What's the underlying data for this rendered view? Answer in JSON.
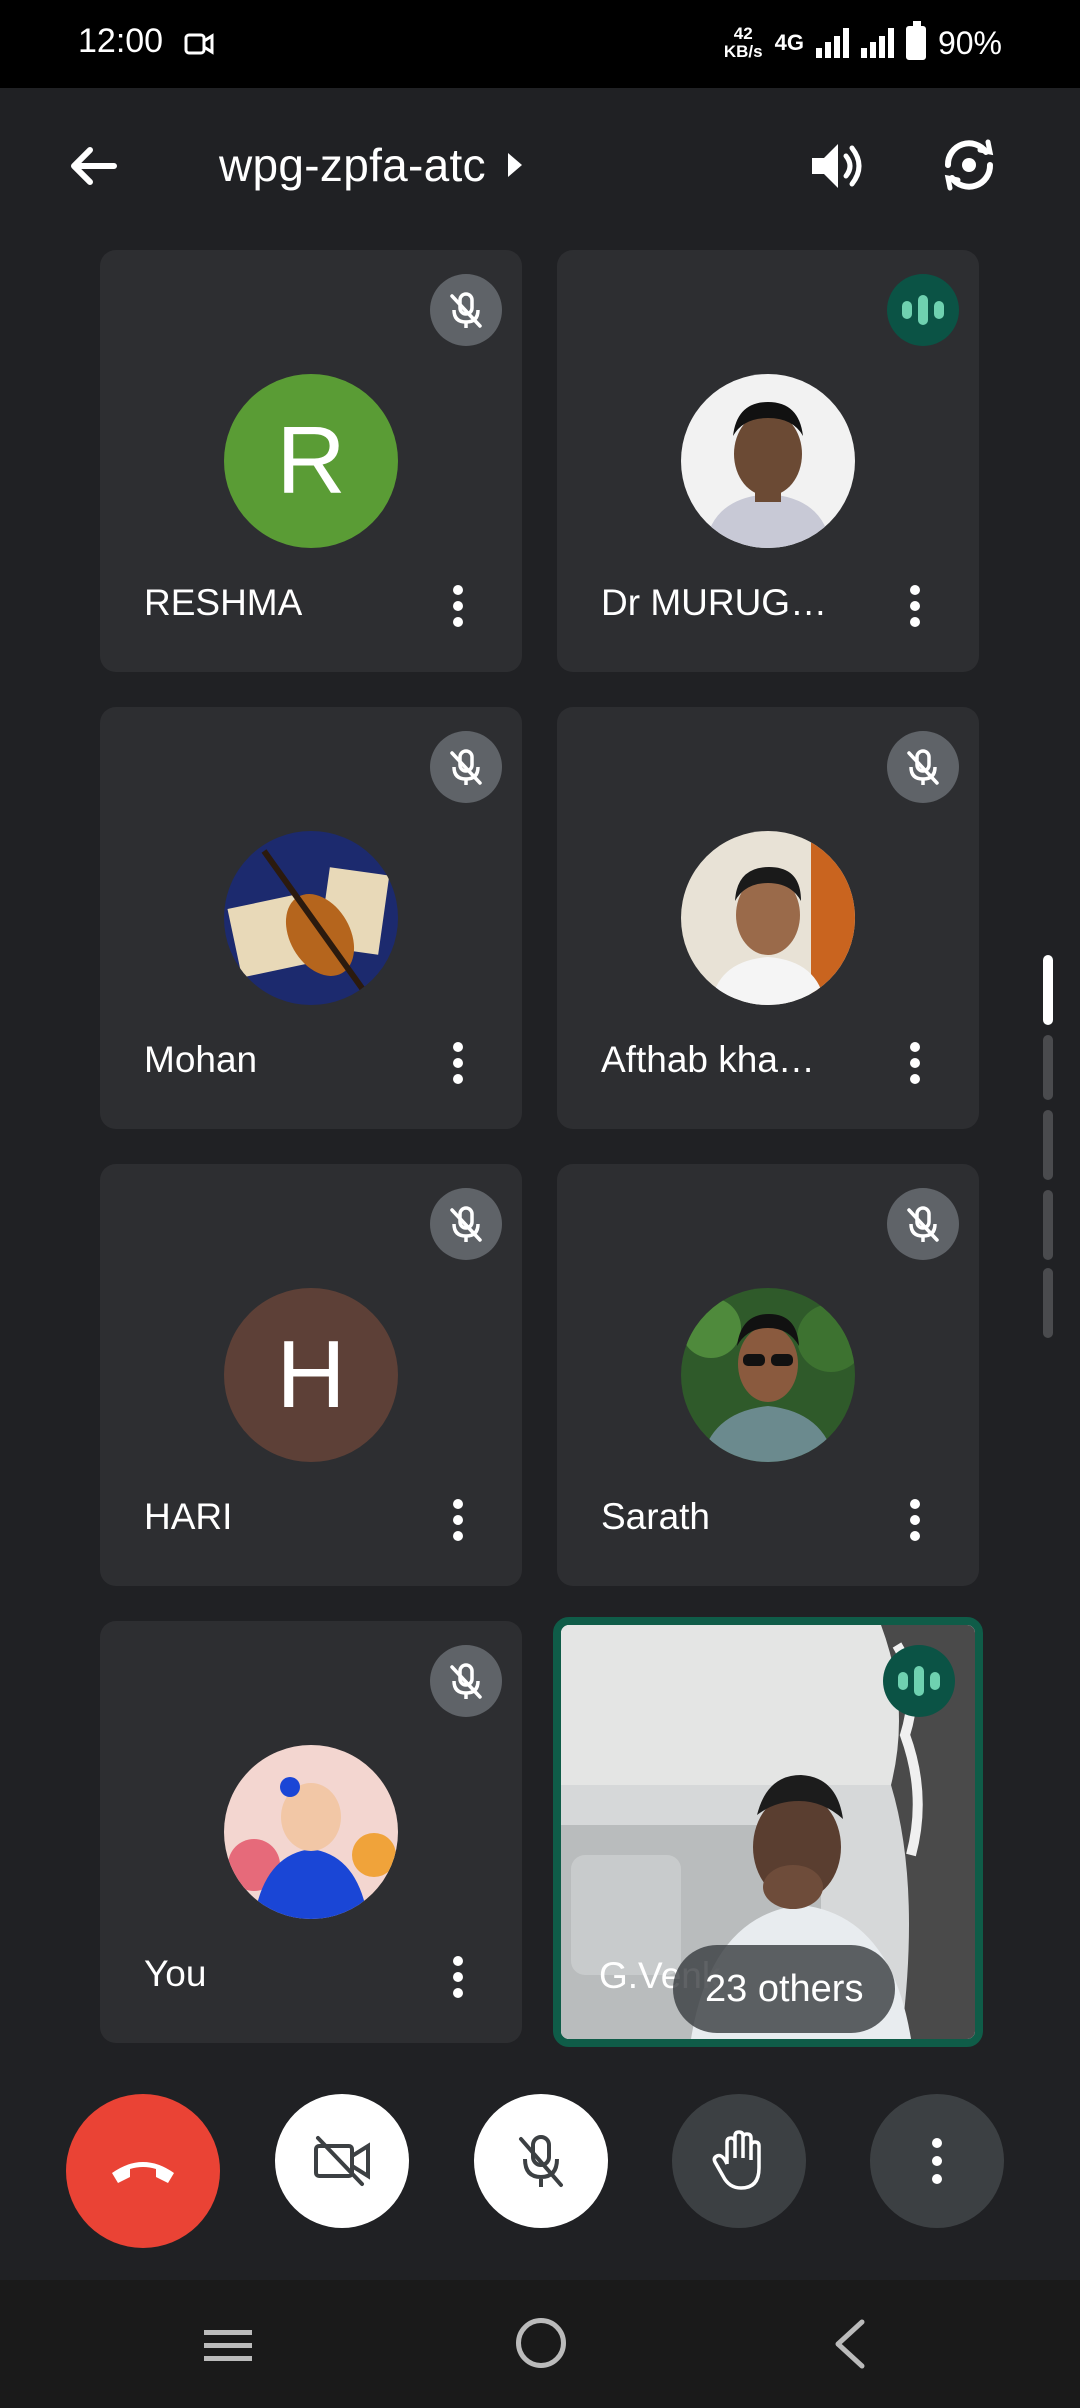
{
  "status_bar": {
    "time": "12:00",
    "net_speed_value": "42",
    "net_speed_unit": "KB/s",
    "network": "4G",
    "battery": "90%"
  },
  "app_bar": {
    "meeting_code": "wpg-zpfa-atc"
  },
  "participants": [
    {
      "name": "RESHMA",
      "avatar_type": "letter",
      "avatar_letter": "R",
      "avatar_color": "#5a9c35",
      "status": "muted"
    },
    {
      "name": "Dr MURUG…",
      "avatar_type": "photo",
      "status": "speaking"
    },
    {
      "name": "Mohan",
      "avatar_type": "photo",
      "status": "muted"
    },
    {
      "name": "Afthab kha…",
      "avatar_type": "photo",
      "status": "muted"
    },
    {
      "name": "HARI",
      "avatar_type": "letter",
      "avatar_letter": "H",
      "avatar_color": "#5d4037",
      "status": "muted"
    },
    {
      "name": "Sarath",
      "avatar_type": "photo",
      "status": "muted"
    },
    {
      "name": "You",
      "avatar_type": "photo",
      "status": "muted"
    },
    {
      "name": "G.Venk",
      "avatar_type": "video",
      "status": "speaking",
      "others_label": "23 others"
    }
  ],
  "controls": {
    "end_call_color": "#ea4335"
  }
}
